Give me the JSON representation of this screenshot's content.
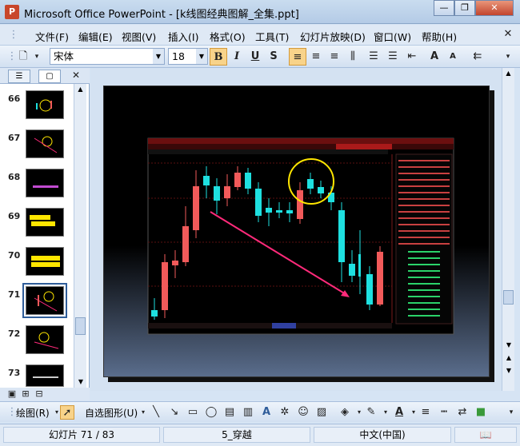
{
  "window": {
    "title": "Microsoft Office PowerPoint - [k线图经典图解_全集.ppt]",
    "app_icon": "P"
  },
  "menu": {
    "items": [
      "文件(F)",
      "编辑(E)",
      "视图(V)",
      "插入(I)",
      "格式(O)",
      "工具(T)",
      "幻灯片放映(D)",
      "窗口(W)",
      "帮助(H)"
    ]
  },
  "format_toolbar": {
    "font": "宋体",
    "size": "18",
    "bold": "B",
    "italic": "I",
    "underline": "U",
    "shadow": "S"
  },
  "slides_pane": {
    "slides": [
      {
        "num": "66"
      },
      {
        "num": "67"
      },
      {
        "num": "68"
      },
      {
        "num": "69"
      },
      {
        "num": "70"
      },
      {
        "num": "71"
      },
      {
        "num": "72"
      },
      {
        "num": "73"
      }
    ],
    "selected": "71"
  },
  "draw_toolbar": {
    "draw_label": "绘图(R)",
    "autoshapes_label": "自选图形(U)"
  },
  "status": {
    "slide_pos": "幻灯片 71 / 83",
    "design": "5_穿越",
    "language": "中文(中国)"
  },
  "colors": {
    "accent": "#2f5d9a",
    "candle_up": "#f25a5a",
    "candle_down": "#1ee0e0",
    "annotation_circle": "#ffe600",
    "annotation_arrow": "#ff2a7a"
  }
}
